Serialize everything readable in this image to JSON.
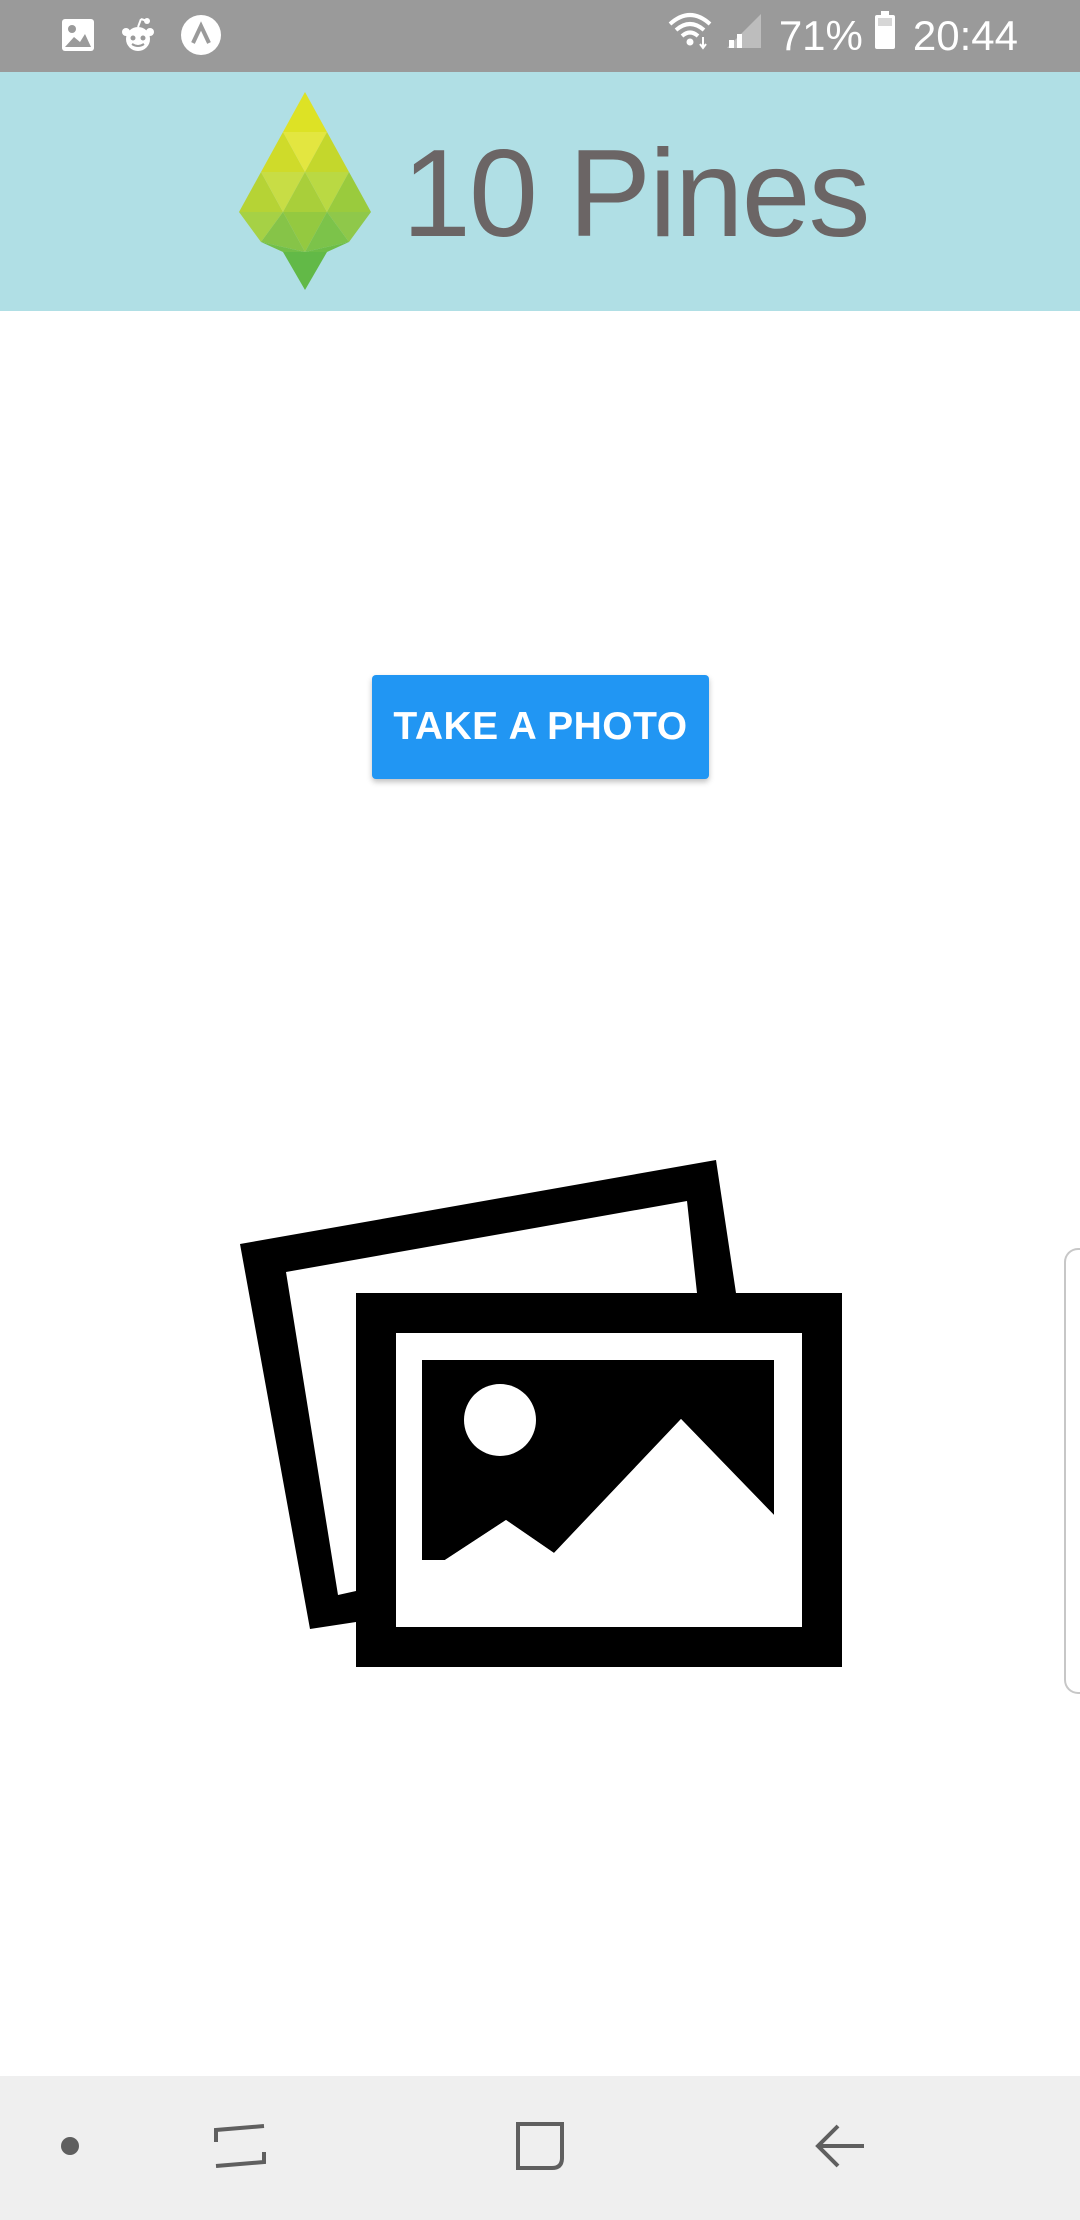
{
  "status_bar": {
    "left_icons": [
      "gallery-icon",
      "reddit-icon",
      "app-icon"
    ],
    "battery_percent": "71%",
    "time": "20:44"
  },
  "header": {
    "logo_text": "10 Pines",
    "background_color": "#b0dfe5"
  },
  "main": {
    "take_photo_label": "TAKE A PHOTO",
    "button_color": "#2196f3",
    "placeholder_icon": "photos-placeholder-icon"
  },
  "nav_bar": {
    "items": [
      "dot-icon",
      "recent-apps-icon",
      "home-icon",
      "back-icon"
    ]
  }
}
